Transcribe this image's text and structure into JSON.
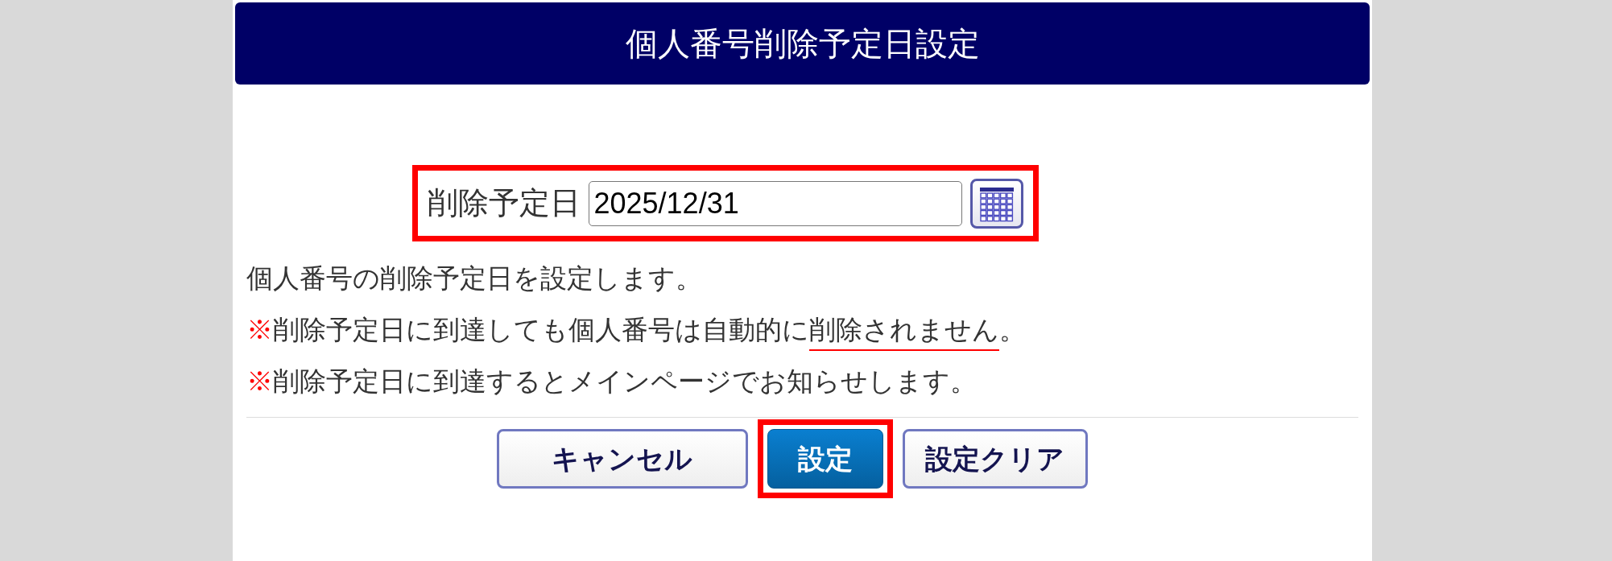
{
  "title": "個人番号削除予定日設定",
  "date_field": {
    "label": "削除予定日",
    "value": "2025/12/31",
    "highlighted": true
  },
  "messages": [
    [
      {
        "text": "個人番号の削除予定日を設定します。",
        "kind": "plain"
      }
    ],
    [
      {
        "text": "※",
        "kind": "mark"
      },
      {
        "text": "削除予定日に到達しても個人番号は自動的に",
        "kind": "plain"
      },
      {
        "text": "削除されません",
        "kind": "emphasis"
      },
      {
        "text": "。",
        "kind": "plain"
      }
    ],
    [
      {
        "text": "※",
        "kind": "mark"
      },
      {
        "text": "削除予定日に到達するとメインページでお知らせします。",
        "kind": "plain"
      }
    ]
  ],
  "buttons": [
    {
      "label": "キャンセル",
      "kind": "default",
      "highlighted": false
    },
    {
      "label": "設定",
      "kind": "primary",
      "highlighted": true
    },
    {
      "label": "設定クリア",
      "kind": "default",
      "highlighted": false
    }
  ]
}
